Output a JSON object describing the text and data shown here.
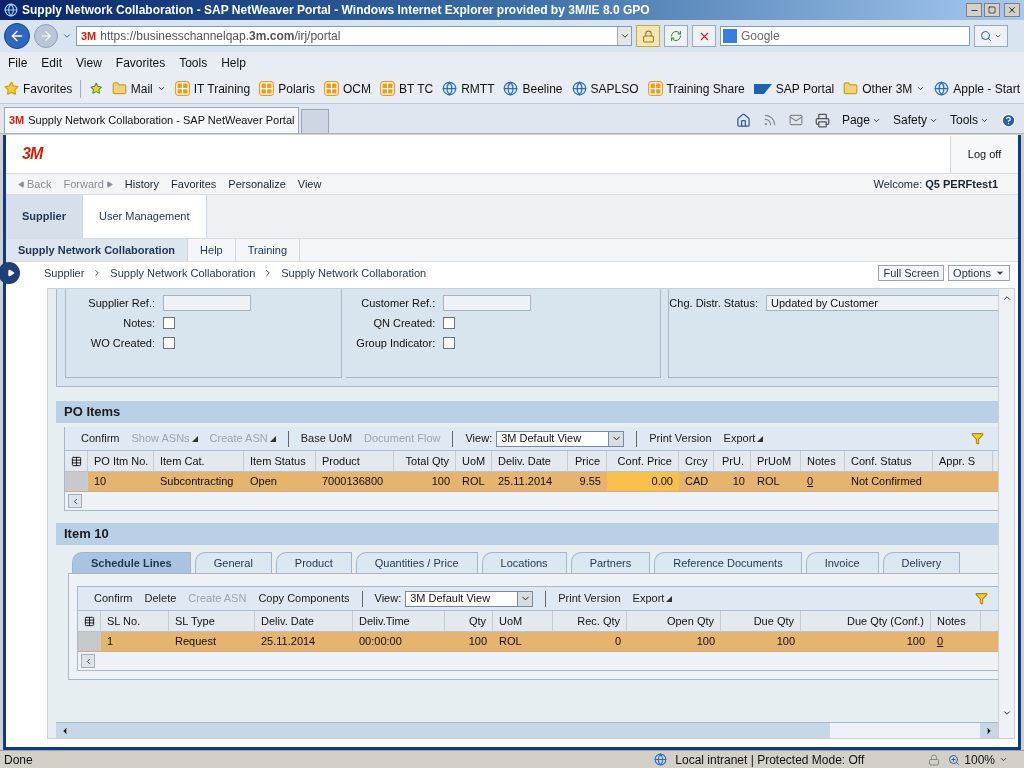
{
  "window": {
    "title": "Supply Network Collaboration - SAP NetWeaver Portal - Windows Internet Explorer provided by 3M/IE 8.0 GPO"
  },
  "address": {
    "badge": "3M",
    "url": "https://businesschannelqap.**3m.com**/irj/portal"
  },
  "search": {
    "placeholder": "Google"
  },
  "menu": [
    "File",
    "Edit",
    "View",
    "Favorites",
    "Tools",
    "Help"
  ],
  "favorites_bar": {
    "label": "Favorites",
    "items": [
      {
        "label": "Mail",
        "kind": "folder",
        "dropdown": true
      },
      {
        "label": "IT Training",
        "kind": "app",
        "dropdown": false
      },
      {
        "label": "Polaris",
        "kind": "app",
        "dropdown": false
      },
      {
        "label": "OCM",
        "kind": "app",
        "dropdown": false
      },
      {
        "label": "BT TC",
        "kind": "app",
        "dropdown": false
      },
      {
        "label": "RMTT",
        "kind": "page",
        "dropdown": false
      },
      {
        "label": "Beeline",
        "kind": "page",
        "dropdown": false
      },
      {
        "label": "SAPLSO",
        "kind": "page",
        "dropdown": false
      },
      {
        "label": "Training Share",
        "kind": "app",
        "dropdown": false
      },
      {
        "label": "SAP Portal",
        "kind": "sap",
        "dropdown": false
      },
      {
        "label": "Other 3M",
        "kind": "folder",
        "dropdown": true
      },
      {
        "label": "Apple - Start",
        "kind": "page",
        "dropdown": false
      }
    ]
  },
  "tabs": [
    {
      "badge": "3M",
      "label": "Supply Network Collaboration - SAP NetWeaver Portal",
      "selected": true
    }
  ],
  "command_bar": [
    "Page",
    "Safety",
    "Tools"
  ],
  "portal": {
    "logo": "3M",
    "logoff": "Log off",
    "history_nav": [
      {
        "label": "Back",
        "disabled": true
      },
      {
        "label": "Forward",
        "disabled": true
      }
    ],
    "links": [
      "History",
      "Favorites",
      "Personalize",
      "View"
    ],
    "welcome": "Welcome: **Q5 PERFtest1**",
    "top_tabs": [
      {
        "label": "Supplier",
        "selected": true
      },
      {
        "label": "User Management",
        "selected": false
      }
    ],
    "sub_tabs": [
      {
        "label": "Supply Network Collaboration",
        "selected": true
      },
      {
        "label": "Help",
        "selected": false
      },
      {
        "label": "Training",
        "selected": false
      }
    ],
    "breadcrumb": [
      "Supplier",
      "Supply Network Collaboration",
      "Supply Network Collaboration"
    ],
    "buttons": [
      "Full Screen",
      "Options"
    ]
  },
  "form": {
    "columns": [
      [
        {
          "label": "Supplier Ref.:",
          "kind": "text"
        },
        {
          "label": "Notes:",
          "kind": "checkbox",
          "checked": false
        },
        {
          "label": "WO Created:",
          "kind": "checkbox",
          "checked": false
        }
      ],
      [
        {
          "label": "Customer Ref.:",
          "kind": "text"
        },
        {
          "label": "QN Created:",
          "kind": "checkbox",
          "checked": false
        },
        {
          "label": "Group Indicator:",
          "kind": "checkbox",
          "checked": false
        }
      ],
      [
        {
          "label": "Chg. Distr. Status:",
          "kind": "text",
          "value": "Updated by Customer"
        }
      ]
    ]
  },
  "po_items": {
    "title": "PO Items",
    "toolbar": [
      {
        "label": "Confirm",
        "kind": "button",
        "disabled": false
      },
      {
        "label": "Show ASNs",
        "kind": "menu",
        "disabled": true
      },
      {
        "label": "Create ASN",
        "kind": "menu",
        "disabled": true
      },
      {
        "kind": "separator"
      },
      {
        "label": "Base UoM",
        "kind": "button",
        "disabled": false
      },
      {
        "label": "Document Flow",
        "kind": "button",
        "disabled": true
      },
      {
        "kind": "separator"
      },
      {
        "label": "View:",
        "kind": "view",
        "value": "3M Default View"
      },
      {
        "kind": "separator"
      },
      {
        "label": "Print Version",
        "kind": "button",
        "disabled": false
      },
      {
        "label": "Export",
        "kind": "menu",
        "disabled": false
      }
    ],
    "columns": [
      {
        "label": "PO Itm No."
      },
      {
        "label": "Item Cat."
      },
      {
        "label": "Item Status"
      },
      {
        "label": "Product"
      },
      {
        "label": "Total Qty",
        "numeric": true
      },
      {
        "label": "UoM"
      },
      {
        "label": "Deliv. Date"
      },
      {
        "label": "Price",
        "numeric": true
      },
      {
        "label": "Conf. Price",
        "numeric": true,
        "editable": true
      },
      {
        "label": "Crcy"
      },
      {
        "label": "PrU.",
        "numeric": true
      },
      {
        "label": "PrUoM"
      },
      {
        "label": "Notes",
        "link": true
      },
      {
        "label": "Conf. Status"
      },
      {
        "label": "Appr. S"
      }
    ],
    "rows": [
      {
        "selected": true,
        "cells": [
          "10",
          "Subcontracting",
          "Open",
          "7000136800",
          "100",
          "ROL",
          "25.11.2014",
          "9.55",
          "0.00",
          "CAD",
          "10",
          "ROL",
          "0",
          "Not Confirmed",
          ""
        ]
      }
    ]
  },
  "item": {
    "title": "Item 10",
    "tabs": [
      {
        "label": "Schedule Lines",
        "selected": true
      },
      {
        "label": "General",
        "selected": false
      },
      {
        "label": "Product",
        "selected": false
      },
      {
        "label": "Quantities / Price",
        "selected": false
      },
      {
        "label": "Locations",
        "selected": false
      },
      {
        "label": "Partners",
        "selected": false
      },
      {
        "label": "Reference Documents",
        "selected": false
      },
      {
        "label": "Invoice",
        "selected": false
      },
      {
        "label": "Delivery",
        "selected": false
      }
    ],
    "toolbar": [
      {
        "label": "Confirm",
        "kind": "button",
        "disabled": false
      },
      {
        "label": "Delete",
        "kind": "button",
        "disabled": false
      },
      {
        "label": "Create ASN",
        "kind": "button",
        "disabled": true
      },
      {
        "label": "Copy Components",
        "kind": "button",
        "disabled": false
      },
      {
        "kind": "separator"
      },
      {
        "label": "View:",
        "kind": "view",
        "value": "3M Default View"
      },
      {
        "kind": "separator"
      },
      {
        "label": "Print Version",
        "kind": "button",
        "disabled": false
      },
      {
        "label": "Export",
        "kind": "menu",
        "disabled": false
      }
    ],
    "columns": [
      {
        "label": "SL No."
      },
      {
        "label": "SL Type"
      },
      {
        "label": "Deliv. Date"
      },
      {
        "label": "Deliv.Time"
      },
      {
        "label": "Qty",
        "numeric": true
      },
      {
        "label": "UoM"
      },
      {
        "label": "Rec. Qty",
        "numeric": true
      },
      {
        "label": "Open Qty",
        "numeric": true
      },
      {
        "label": "Due Qty",
        "numeric": true
      },
      {
        "label": "Due Qty (Conf.)",
        "numeric": true
      },
      {
        "label": "Notes",
        "link": true
      }
    ],
    "rows": [
      {
        "selected": true,
        "cells": [
          "1",
          "Request",
          "25.11.2014",
          "00:00:00",
          "100",
          "ROL",
          "0",
          "100",
          "100",
          "100",
          "0"
        ]
      }
    ]
  },
  "status_bar": {
    "text": "Done",
    "zone": "Local intranet | Protected Mode: Off",
    "zoom": "100%"
  }
}
